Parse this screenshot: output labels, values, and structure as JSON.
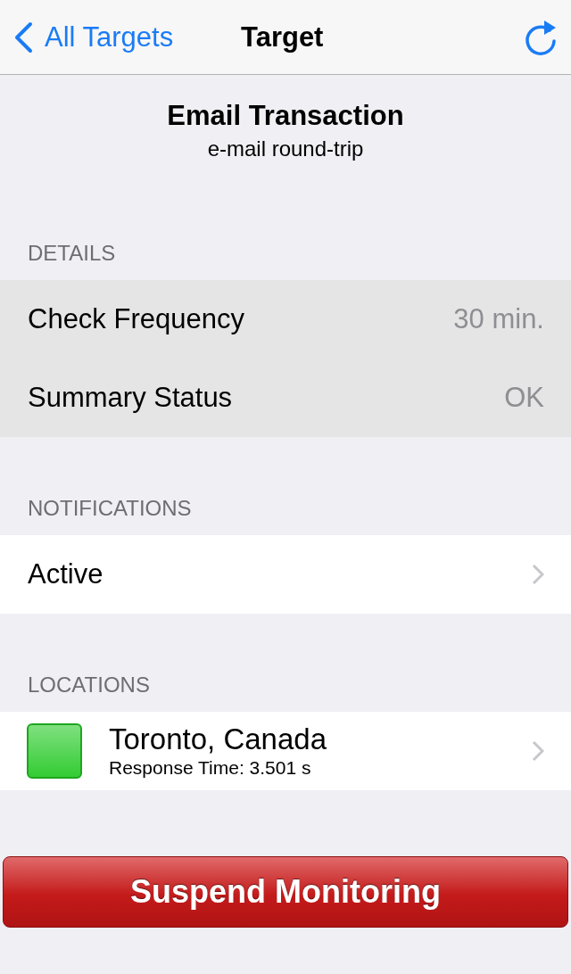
{
  "nav": {
    "back": "All Targets",
    "title": "Target"
  },
  "header": {
    "title": "Email Transaction",
    "subtitle": "e-mail round-trip"
  },
  "sections": [
    {
      "title": "DETAILS",
      "rows": [
        {
          "kind": "value",
          "label": "Check Frequency",
          "value": "30 min."
        },
        {
          "kind": "value",
          "label": "Summary Status",
          "value": "OK"
        }
      ]
    },
    {
      "title": "NOTIFICATIONS",
      "rows": [
        {
          "kind": "link",
          "label": "Active"
        }
      ]
    },
    {
      "title": "LOCATIONS",
      "rows": [
        {
          "kind": "location",
          "label": "Toronto, Canada",
          "detail": "Response Time: 3.501 s",
          "color": "#33cc33"
        }
      ]
    }
  ],
  "button": "Suspend Monitoring"
}
